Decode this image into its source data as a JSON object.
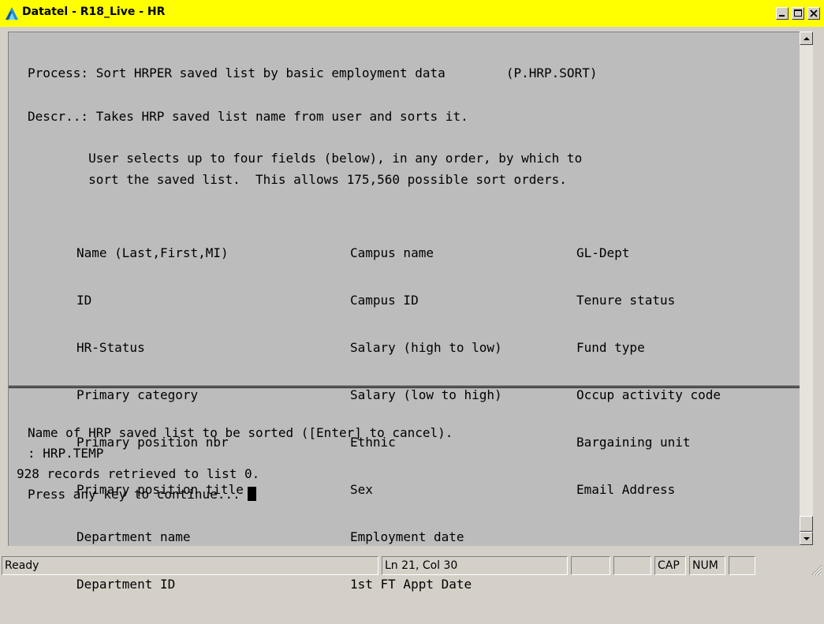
{
  "window": {
    "title": "Datatel - R18_Live - HR",
    "colors": {
      "titlebar": "#ffff00",
      "terminal_bg": "#bcbcbc",
      "chrome": "#d4d0c8"
    }
  },
  "terminal": {
    "process_line": "Process: Sort HRPER saved list by basic employment data        (P.HRP.SORT)",
    "descr_line": "Descr..: Takes HRP saved list name from user and sorts it.",
    "descr_line2": "        User selects up to four fields (below), in any order, by which to",
    "descr_line3": "        sort the saved list.  This allows 175,560 possible sort orders.",
    "fields_col1": [
      "Name (Last,First,MI)",
      "ID",
      "HR-Status",
      "Primary category",
      "Primary position nbr",
      "Primary position title",
      "Department name",
      "Department ID"
    ],
    "fields_col2": [
      "Campus name",
      "Campus ID",
      "Salary (high to low)",
      "Salary (low to high)",
      "Ethnic",
      "Sex",
      "Employment date",
      "1st FT Appt Date"
    ],
    "fields_col3": [
      "GL-Dept",
      "Tenure status",
      "Fund type",
      "Occup activity code",
      "Bargaining unit",
      "Email Address"
    ],
    "prompt_line": "Name of HRP saved list to be sorted ([Enter] to cancel).",
    "input_line": ": HRP.TEMP",
    "result_line": "928 records retrieved to list 0.",
    "continue_line": "Press any key to continue... "
  },
  "statusbar": {
    "ready": "Ready",
    "position": "Ln 21, Col 30",
    "cap": "CAP",
    "num": "NUM"
  },
  "icons": {
    "app": "datatel-app-icon",
    "minimize": "minimize-icon",
    "maximize": "maximize-icon",
    "close": "close-icon",
    "scroll_up": "arrow-up-icon",
    "scroll_down": "arrow-down-icon",
    "resize": "resize-grip-icon"
  }
}
